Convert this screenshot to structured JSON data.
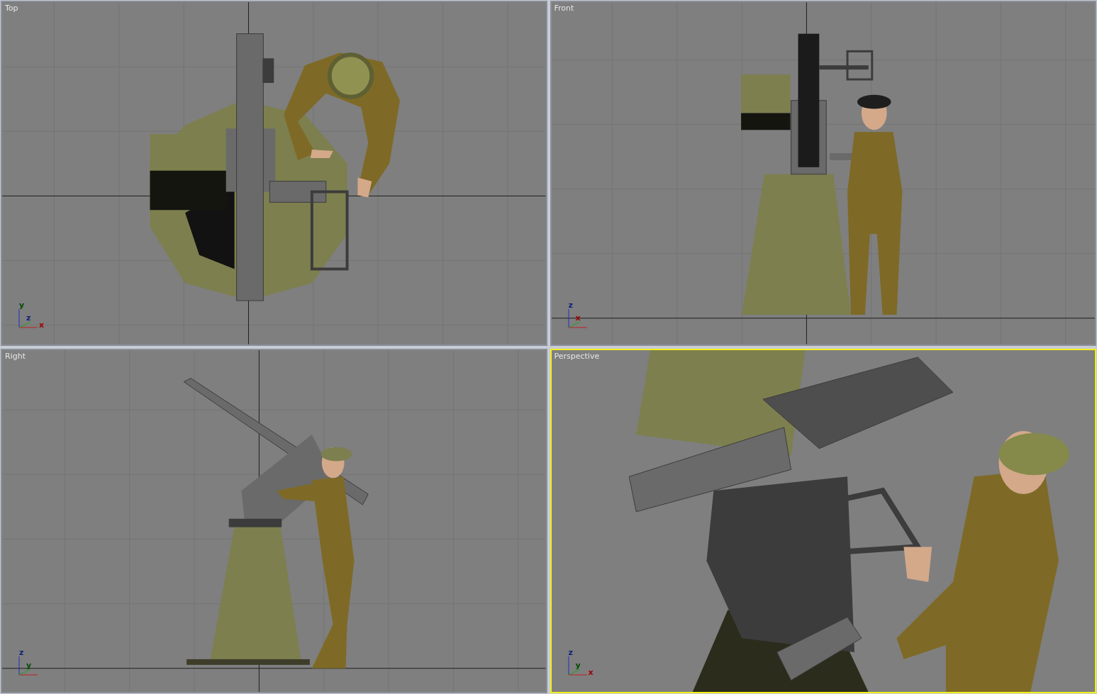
{
  "viewports": [
    {
      "label": "Top",
      "kind": "top",
      "selected": false,
      "axes": [
        "y",
        "z",
        "x"
      ]
    },
    {
      "label": "Front",
      "kind": "front",
      "selected": false,
      "axes": [
        "z",
        "x"
      ]
    },
    {
      "label": "Right",
      "kind": "right",
      "selected": false,
      "axes": [
        "z",
        "y"
      ]
    },
    {
      "label": "Perspective",
      "kind": "perspective",
      "selected": true,
      "axes": [
        "z",
        "y",
        "x"
      ]
    }
  ]
}
